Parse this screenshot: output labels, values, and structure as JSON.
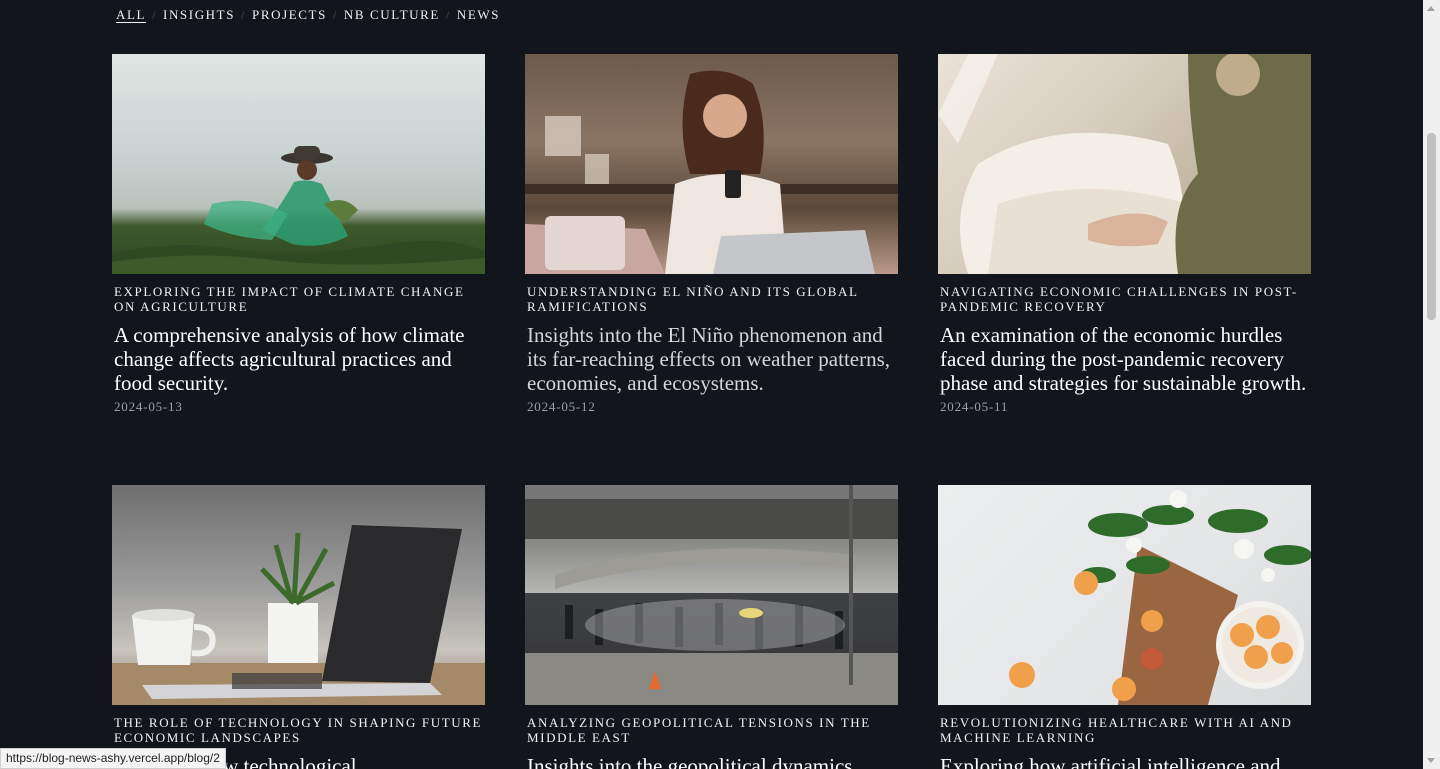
{
  "filters": [
    {
      "label": "All",
      "active": true
    },
    {
      "label": "Insights",
      "active": false
    },
    {
      "label": "Projects",
      "active": false
    },
    {
      "label": "NB Culture",
      "active": false
    },
    {
      "label": "News",
      "active": false
    }
  ],
  "posts": [
    {
      "category": "Exploring the Impact of Climate Change on Agriculture",
      "description": "A comprehensive analysis of how climate change affects agricultural practices and food security.",
      "date": "2024-05-13",
      "image": "woman-in-green-dress-field"
    },
    {
      "category": "Understanding El Niño and Its Global Ramifications",
      "description": "Insights into the El Niño phenomenon and its far-reaching effects on weather patterns, economies, and ecosystems.",
      "date": "2024-05-12",
      "image": "woman-with-phone-and-laptop"
    },
    {
      "category": "Navigating Economic Challenges in Post-Pandemic Recovery",
      "description": "An examination of the economic hurdles faced during the post-pandemic recovery phase and strategies for sustainable growth.",
      "date": "2024-05-11",
      "image": "woman-making-bed"
    },
    {
      "category": "The Role of Technology in Shaping Future Economic Landscapes",
      "description": "A look on how technological",
      "date": "",
      "image": "laptop-coffee-cup-plant"
    },
    {
      "category": "Analyzing Geopolitical Tensions in the Middle East",
      "description": "Insights into the geopolitical dynamics",
      "date": "",
      "image": "street-protest-crowd"
    },
    {
      "category": "Revolutionizing Healthcare with AI and Machine Learning",
      "description": "Exploring how artificial intelligence and",
      "date": "",
      "image": "apricots-and-flowers"
    }
  ],
  "status_url": "https://blog-news-ashy.vercel.app/blog/2"
}
